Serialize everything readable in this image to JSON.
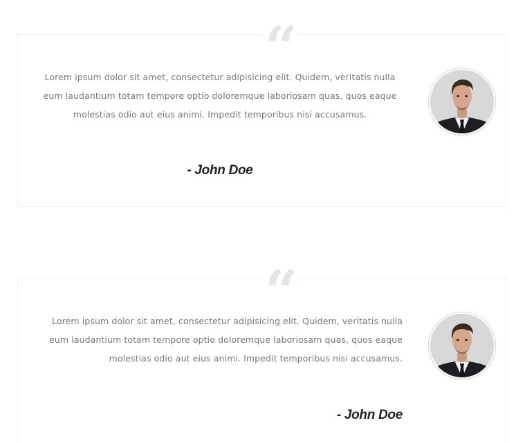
{
  "testimonials": [
    {
      "quote_icon": "quote-open-icon",
      "quote_mark": "“",
      "text": "Lorem ipsum dolor sit amet, consectetur adipisicing elit. Quidem, veritatis nulla eum laudantium totam tempore optio doloremque laboriosam quas, quos eaque molestias odio aut eius animi. Impedit temporibus nisi accusamus.",
      "author": "- John Doe",
      "alignment": "center"
    },
    {
      "quote_icon": "quote-open-icon",
      "quote_mark": "“",
      "text": "Lorem ipsum dolor sit amet, consectetur adipisicing elit. Quidem, veritatis nulla eum laudantium totam tempore optio doloremque laboriosam quas, quos eaque molestias odio aut eius animi. Impedit temporibus nisi accusamus.",
      "author": "- John Doe",
      "alignment": "right"
    }
  ],
  "colors": {
    "text": "#777777",
    "author": "#222222",
    "quote_mark": "#e4e4e4",
    "card_border": "#ececec"
  }
}
